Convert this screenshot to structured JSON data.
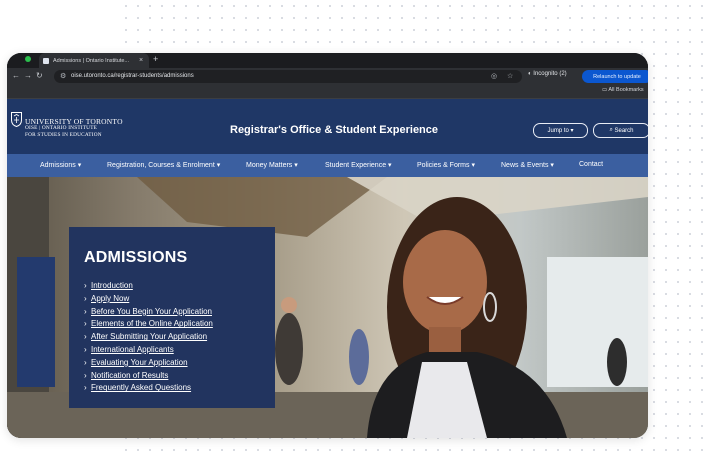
{
  "browser": {
    "tab_title": "Admissions | Ontario Institute...",
    "url": "oise.utoronto.ca/registrar-students/admissions",
    "incognito_label": "Incognito (2)",
    "relaunch_label": "Relaunch to update",
    "bookmarks_label": "All Bookmarks"
  },
  "site": {
    "logo_line1": "UNIVERSITY OF TORONTO",
    "logo_line2": "OISE | ONTARIO INSTITUTE",
    "logo_line3": "FOR STUDIES IN EDUCATION",
    "title": "Registrar's Office & Student Experience",
    "jump_label": "Jump to",
    "search_label": "Search"
  },
  "nav": {
    "items": [
      {
        "label": "Admissions ▾"
      },
      {
        "label": "Registration, Courses & Enrolment ▾"
      },
      {
        "label": "Money Matters ▾"
      },
      {
        "label": "Student Experience ▾"
      },
      {
        "label": "Policies & Forms ▾"
      },
      {
        "label": "News & Events ▾"
      },
      {
        "label": "Contact"
      }
    ]
  },
  "panel": {
    "title": "ADMISSIONS",
    "links": [
      {
        "label": "Introduction"
      },
      {
        "label": "Apply Now"
      },
      {
        "label": "Before You Begin Your Application"
      },
      {
        "label": "Elements of the Online Application"
      },
      {
        "label": "After Submitting Your Application"
      },
      {
        "label": "International Applicants"
      },
      {
        "label": "Evaluating Your Application"
      },
      {
        "label": "Notification of Results"
      },
      {
        "label": "Frequently Asked Questions"
      }
    ]
  },
  "icons": {
    "back": "arrow-back-icon",
    "forward": "arrow-forward-icon",
    "reload": "reload-icon",
    "site_settings": "tune-icon",
    "eye_off": "eye-off-icon",
    "star": "star-icon",
    "incognito": "incognito-icon",
    "folder": "folder-icon",
    "search": "search-icon",
    "crest": "crest-icon"
  },
  "colors": {
    "header_blue": "#1f3766",
    "nav_blue": "#3b5fa0",
    "panel_blue": "#22345f",
    "relaunch_blue": "#0b57d0"
  }
}
